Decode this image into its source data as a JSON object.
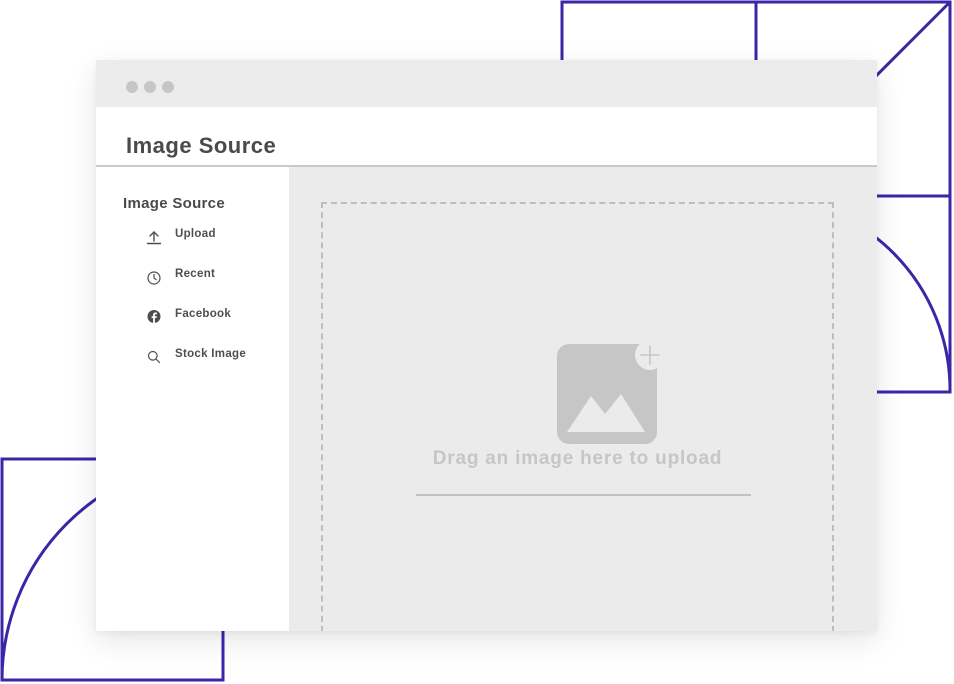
{
  "colors": {
    "decor_accent": "#3a27a8",
    "titlebar_bg": "#ececec",
    "content_bg": "#ebebeb",
    "text_dark": "#4a4a4a",
    "text_muted": "#c6c6c6"
  },
  "window": {
    "controls": [
      "window-dot",
      "window-dot",
      "window-dot"
    ]
  },
  "header": {
    "title": "Image Source"
  },
  "sidebar": {
    "title": "Image Source",
    "items": [
      {
        "label": "Upload",
        "icon": "upload-icon"
      },
      {
        "label": "Recent",
        "icon": "clock-icon"
      },
      {
        "label": "Facebook",
        "icon": "facebook-icon"
      },
      {
        "label": "Stock Image",
        "icon": "search-icon"
      }
    ]
  },
  "dropzone": {
    "icon": "image-add-icon",
    "text": "Drag an image here to upload"
  }
}
